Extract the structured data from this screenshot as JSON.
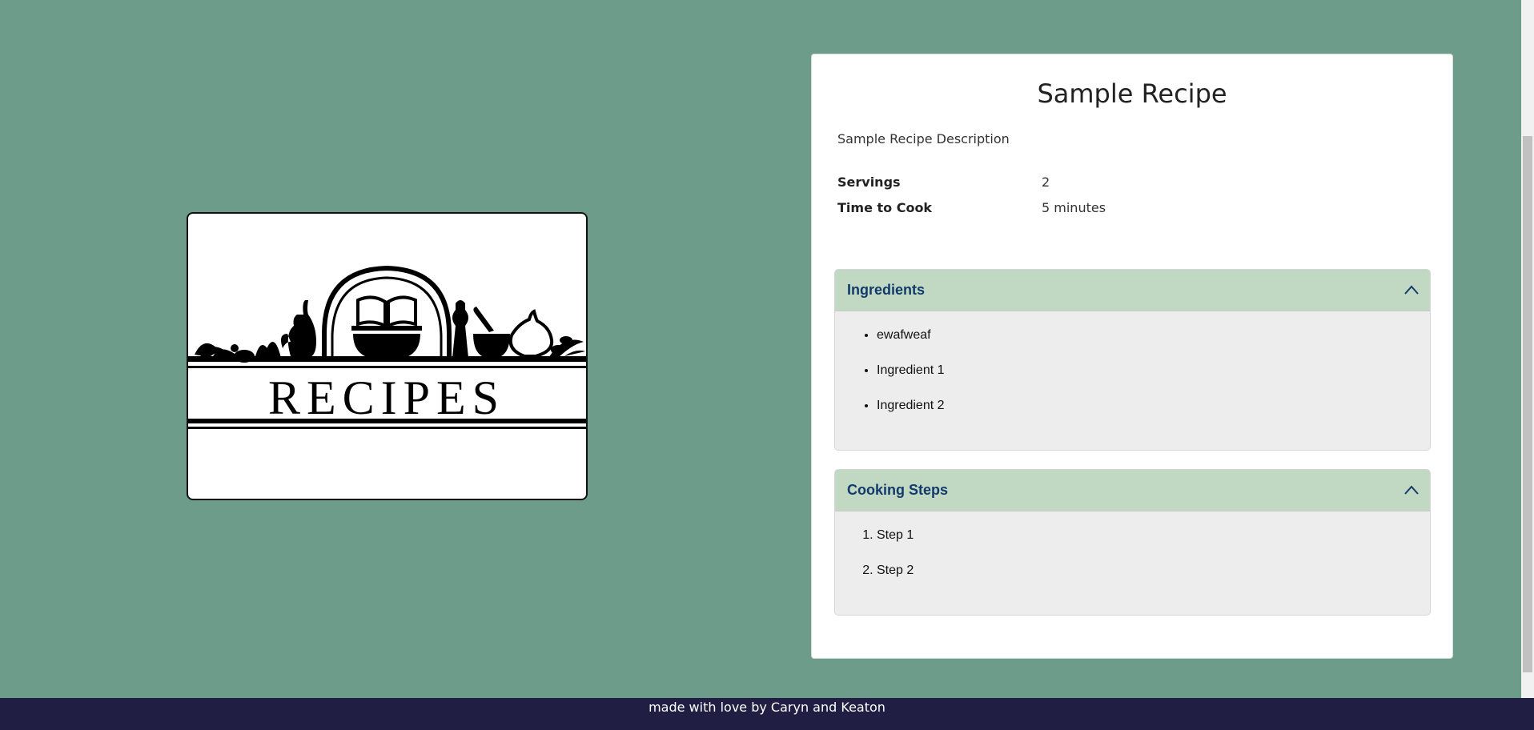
{
  "logo": {
    "text": "RECIPES"
  },
  "recipe": {
    "title": "Sample Recipe",
    "description": "Sample Recipe Description",
    "details": [
      {
        "label": "Servings",
        "value": "2"
      },
      {
        "label": "Time to Cook",
        "value": "5 minutes"
      }
    ]
  },
  "ingredients": {
    "title": "Ingredients",
    "expanded": true,
    "items": [
      "ewafweaf",
      "Ingredient 1",
      "Ingredient 2"
    ]
  },
  "steps": {
    "title": "Cooking Steps",
    "expanded": true,
    "items": [
      "Step 1",
      "Step 2"
    ]
  },
  "footer": {
    "text": "made with love by Caryn and Keaton"
  },
  "colors": {
    "page_background": "#6d9c8b",
    "accordion_header": "#c1d9c3",
    "accordion_title": "#123a6b",
    "footer_background": "#211e43"
  },
  "icons": {
    "accordion_toggle": "chevron-up-icon",
    "logo_art": "cookbook-bowl-icon"
  }
}
